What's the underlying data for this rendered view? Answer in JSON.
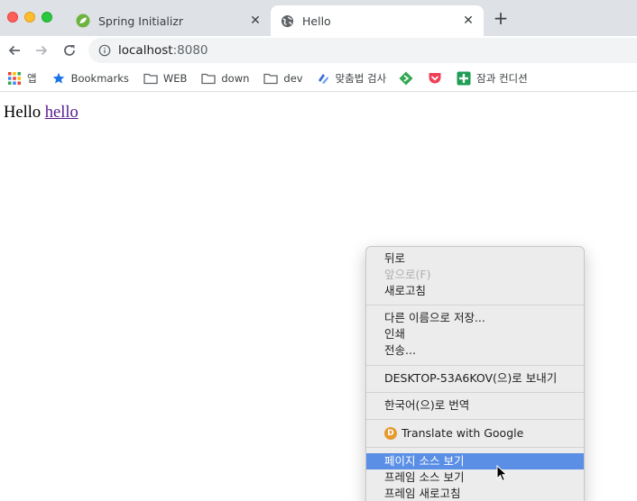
{
  "window": {
    "tabs": [
      {
        "title": "Spring Initializr",
        "icon": "spring-leaf-icon",
        "active": false
      },
      {
        "title": "Hello",
        "icon": "globe-icon",
        "active": true
      }
    ],
    "new_tab_label": "+"
  },
  "toolbar": {
    "url_host": "localhost",
    "url_port": ":8080"
  },
  "bookmarks": [
    {
      "label": "앱",
      "icon": "apps-grid-icon"
    },
    {
      "label": "Bookmarks",
      "icon": "star-icon"
    },
    {
      "label": "WEB",
      "icon": "folder-icon"
    },
    {
      "label": "down",
      "icon": "folder-icon"
    },
    {
      "label": "dev",
      "icon": "folder-icon"
    },
    {
      "label": "맞춤법 검사",
      "icon": "spellcheck-icon"
    },
    {
      "label": "",
      "icon": "green-diamond-icon"
    },
    {
      "label": "",
      "icon": "pocket-icon"
    },
    {
      "label": "잠과 컨디션",
      "icon": "green-plus-icon"
    }
  ],
  "page": {
    "text": "Hello",
    "link": "hello"
  },
  "context_menu": {
    "back": "뒤로",
    "forward": "앞으로(F)",
    "reload": "새로고침",
    "save_as": "다른 이름으로 저장...",
    "print": "인쇄",
    "cast": "전송...",
    "send_to": "DESKTOP-53A6KOV(으)로 보내기",
    "translate_ko": "한국어(으)로 번역",
    "translate_google": "Translate with Google",
    "view_source": "페이지 소스 보기",
    "frame_source": "프레임 소스 보기",
    "frame_reload": "프레임 새로고침"
  },
  "colors": {
    "highlight": "#5b8fe6",
    "visited_link": "#551a8b"
  }
}
